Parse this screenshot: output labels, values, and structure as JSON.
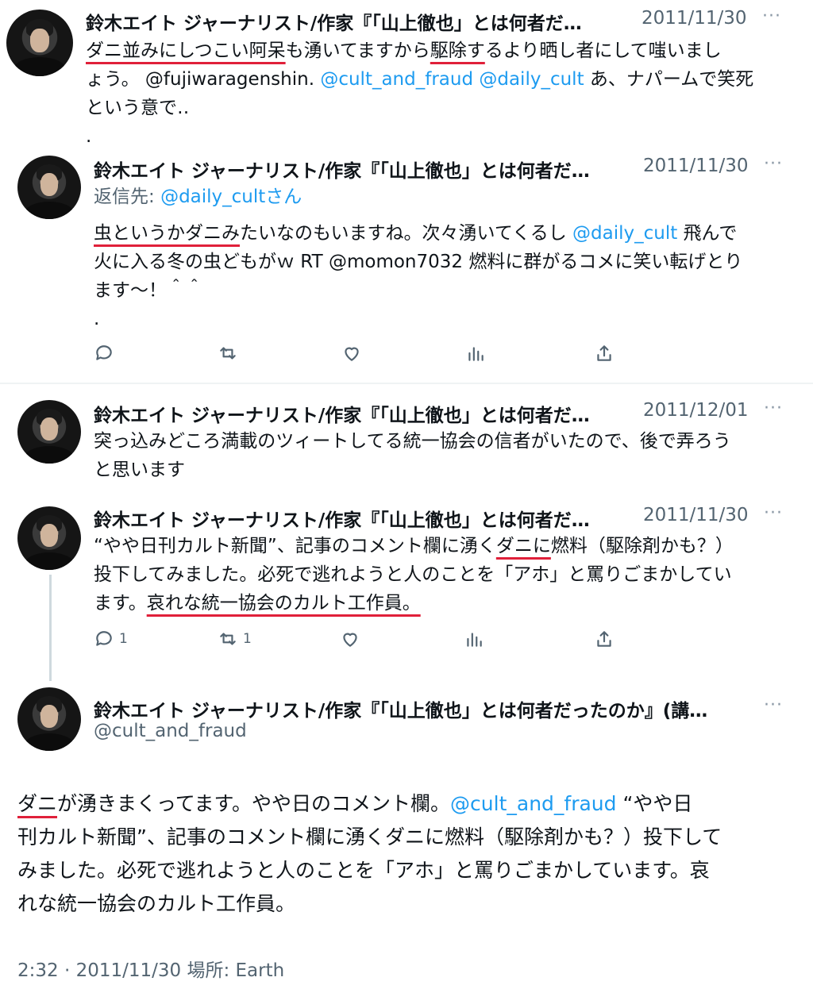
{
  "author_name": "鈴木エイト ジャーナリスト/作家『「山上徹也」とは何者だ…",
  "author_name_long": "鈴木エイト ジャーナリスト/作家『「山上徹也」とは何者だったのか』(講…",
  "handle": "@cult_and_fraud",
  "more_glyph": "···",
  "tweets": [
    {
      "date": "2011/11/30",
      "line1_a": "ダニ並みにしつこい阿呆",
      "line1_b": "も湧いてますから",
      "line1_c": "駆除す",
      "line1_d": "るより晒し者にして嗤いまし",
      "line2_a": "ょう。 @fujiwaragenshin. ",
      "line2_link": "@cult_and_fraud @daily_cult",
      "line2_b": " あ、ナパームで笑死",
      "line3": "という意で‥",
      "line4": "."
    },
    {
      "date": "2011/11/30",
      "reply_label": "返信先: ",
      "reply_handle": "@daily_cult",
      "reply_suffix": "さん",
      "line1_a": "虫というかダニみ",
      "line1_b": "たいなのもいますね。次々湧いてくるし ",
      "line1_link": "@daily_cult",
      "line1_c": " 飛んで",
      "line2": "火に入る冬の虫どもがｗ RT @momon7032 燃料に群がるコメに笑い転げとり",
      "line3": "ます～！＾＾",
      "line4": "."
    },
    {
      "date": "2011/12/01",
      "line1": "突っ込みどころ満載のツィートしてる統一協会の信者がいたので、後で弄ろう",
      "line2": "と思います"
    },
    {
      "date": "2011/11/30",
      "line1_a": "“やや日刊カルト新聞”、記事のコメント欄に湧く",
      "line1_b": "ダニに",
      "line1_c": "燃料（駆除剤かも？）",
      "line2": "投下してみました。必死で逃れようと人のことを「アホ」と罵りごまかしてい",
      "line3_a": "ます。",
      "line3_b": "哀れな統一協会のカルト工作員。",
      "reply_count": "1",
      "retweet_count": "1"
    },
    {
      "line1_a": "ダニ",
      "line1_b": "が湧きまくってます。やや日のコメント欄。",
      "line1_link": "@cult_and_fraud",
      "line1_c": "  “やや日",
      "line2": "刊カルト新聞”、記事のコメント欄に湧くダニに燃料（駆除剤かも？）投下して",
      "line3": "みました。必死で逃れようと人のことを「アホ」と罵りごまかしています。哀",
      "line4": "れな統一協会のカルト工作員。",
      "footer": "2:32 · 2011/11/30 場所: Earth"
    }
  ],
  "icons": [
    "reply-icon",
    "retweet-icon",
    "like-icon",
    "views-icon",
    "share-icon",
    "more-icon"
  ],
  "colors": {
    "link": "#1d9bf0",
    "underline": "#e0203a",
    "muted": "#536471"
  }
}
